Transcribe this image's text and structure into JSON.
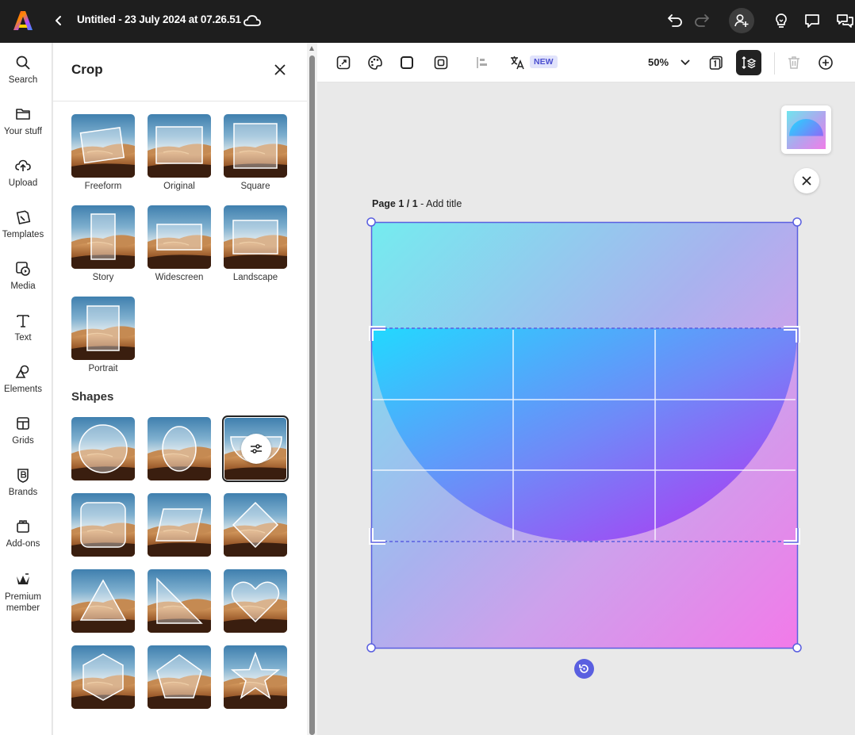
{
  "app": {
    "doc_title": "Untitled - 23 July 2024 at 07.26.51"
  },
  "topbar_icons": [
    "app-logo-icon",
    "back-chevron-icon",
    "cloud-icon",
    "undo-icon",
    "redo-icon",
    "invite-user-icon",
    "lightbulb-icon",
    "comment-icon",
    "chat-icon"
  ],
  "rail": {
    "items": [
      {
        "label": "Search",
        "icon": "search-icon"
      },
      {
        "label": "Your stuff",
        "icon": "folder-icon"
      },
      {
        "label": "Upload",
        "icon": "upload-cloud-icon"
      },
      {
        "label": "Templates",
        "icon": "templates-icon"
      },
      {
        "label": "Media",
        "icon": "media-icon"
      },
      {
        "label": "Text",
        "icon": "text-icon"
      },
      {
        "label": "Elements",
        "icon": "elements-icon"
      },
      {
        "label": "Grids",
        "icon": "grid-icon"
      },
      {
        "label": "Brands",
        "icon": "brand-icon"
      },
      {
        "label": "Add-ons",
        "icon": "addons-icon"
      },
      {
        "label": "Premium member",
        "icon": "premium-crown-icon"
      }
    ]
  },
  "panel": {
    "title": "Crop",
    "crop_options": [
      {
        "label": "Freeform"
      },
      {
        "label": "Original"
      },
      {
        "label": "Square"
      },
      {
        "label": "Story"
      },
      {
        "label": "Widescreen"
      },
      {
        "label": "Landscape"
      },
      {
        "label": "Portrait"
      }
    ],
    "shapes_title": "Shapes",
    "shapes": [
      "circle",
      "ellipse",
      "half-circle",
      "rounded-square",
      "parallelogram",
      "diamond",
      "triangle",
      "right-triangle",
      "heart",
      "hexagon",
      "pentagon",
      "star"
    ],
    "selected_shape": "half-circle"
  },
  "toolbar": {
    "new_badge": "NEW",
    "zoom": "50%"
  },
  "canvas": {
    "page_label_bold": "Page 1 / 1",
    "page_label_rest": " - Add title"
  },
  "colors": {
    "accent": "#5a5fe0",
    "topbar": "#1e1e1e",
    "gradient_start": "#74ecef",
    "gradient_end": "#f27ae9",
    "shape_start": "#22d9ff",
    "shape_end": "#b046f5"
  }
}
